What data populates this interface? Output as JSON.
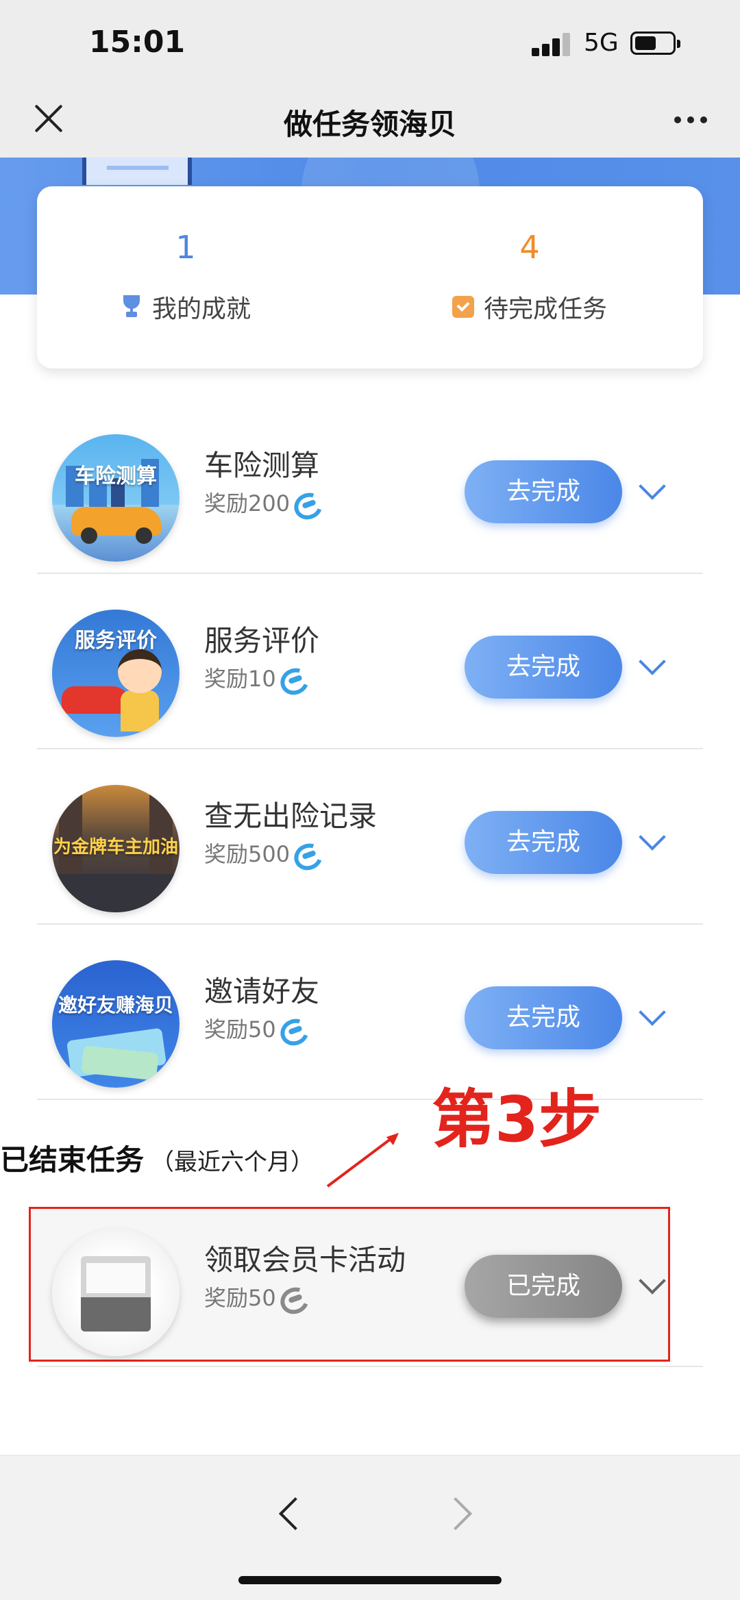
{
  "status_bar": {
    "time": "15:01",
    "network": "5G"
  },
  "nav": {
    "title": "做任务领海贝"
  },
  "stats": {
    "achievements_value": "1",
    "achievements_label": "我的成就",
    "pending_value": "4",
    "pending_label": "待完成任务"
  },
  "tasks": [
    {
      "name": "车险测算",
      "reward": "奖励200",
      "button": "去完成",
      "thumb_text": "车险测算"
    },
    {
      "name": "服务评价",
      "reward": "奖励10",
      "button": "去完成",
      "thumb_text": "服务评价"
    },
    {
      "name": "查无出险记录",
      "reward": "奖励500",
      "button": "去完成",
      "thumb_text": "为金牌车主加油"
    },
    {
      "name": "邀请好友",
      "reward": "奖励50",
      "button": "去完成",
      "thumb_text": "邀好友赚海贝"
    }
  ],
  "annotation": {
    "step": "第3步"
  },
  "ended": {
    "title": "已结束任务",
    "subtitle": "（最近六个月）",
    "task": {
      "name": "领取会员卡活动",
      "reward": "奖励50",
      "button": "已完成"
    }
  },
  "colors": {
    "accent_blue": "#4b87e8",
    "orange": "#ee8c2a",
    "annotation_red": "#e2241d"
  }
}
